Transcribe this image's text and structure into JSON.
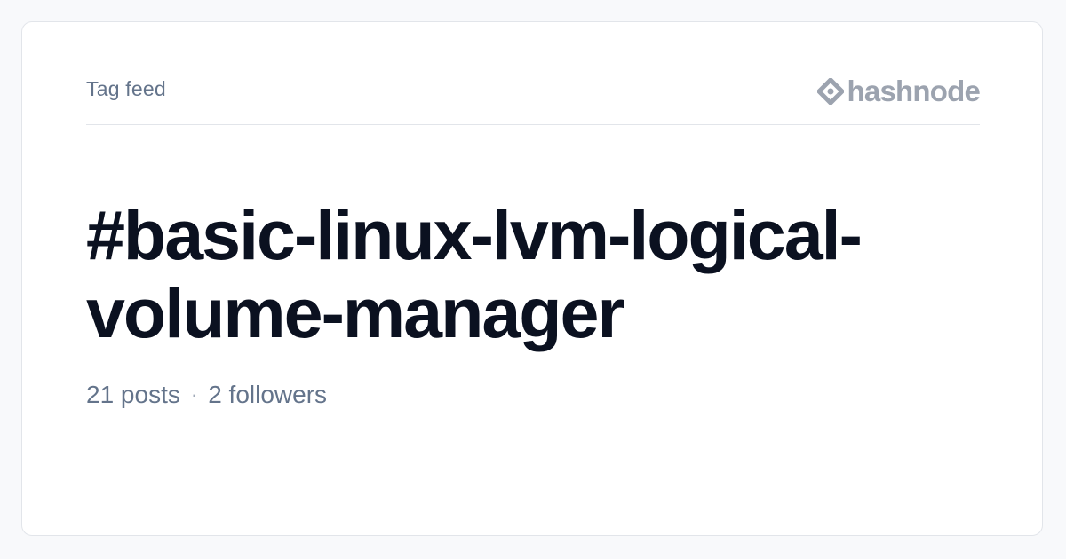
{
  "header": {
    "label": "Tag feed",
    "brand": {
      "icon": "hashnode-logo-icon",
      "name": "hashnode"
    }
  },
  "tag": {
    "title_line1": "#basic-linux-lvm-logical-",
    "title_line2": "volume-manager"
  },
  "stats": {
    "posts": "21 posts",
    "separator": "·",
    "followers": "2 followers"
  },
  "colors": {
    "background": "#f8f9fb",
    "card": "#ffffff",
    "title": "#0b1120",
    "muted": "#64748b",
    "brand": "#9ca3af"
  }
}
